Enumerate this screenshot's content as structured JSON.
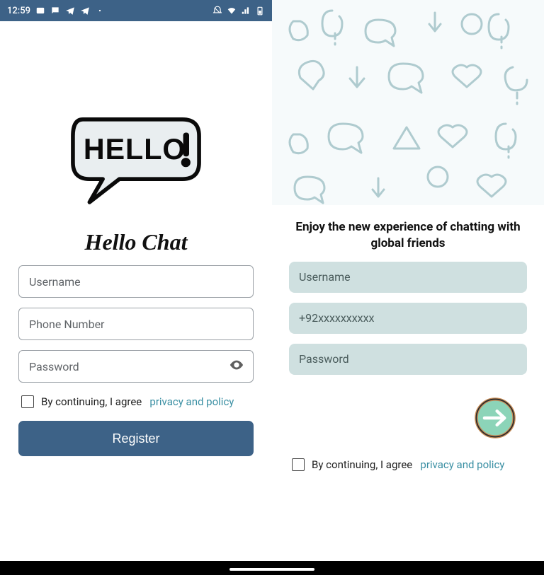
{
  "statusbar": {
    "time": "12:59",
    "left_icons": [
      "image-icon",
      "message-icon",
      "telegram-icon",
      "telegram-icon",
      "dot-icon"
    ],
    "right_icons": [
      "dnd-icon",
      "wifi-icon",
      "signal-icon",
      "battery-icon"
    ]
  },
  "left": {
    "logo_text": "HELLO!",
    "app_title": "Hello Chat",
    "fields": {
      "username_placeholder": "Username",
      "phone_placeholder": "Phone Number",
      "password_placeholder": "Password"
    },
    "agree": {
      "prefix": "By continuing, I agree",
      "link": "privacy and policy"
    },
    "register_label": "Register"
  },
  "right": {
    "headline": "Enjoy the new experience of chatting with global friends",
    "fields": {
      "username_placeholder": "Username",
      "phone_placeholder": "+92xxxxxxxxxx",
      "password_placeholder": "Password"
    },
    "agree": {
      "prefix": "By continuing, I agree",
      "link": "privacy and policy"
    }
  },
  "colors": {
    "primary": "#3d6287",
    "field_bg_right": "#cfe0e0",
    "link": "#3a8fa3",
    "go_fill": "#8cd4b8",
    "go_ring": "#c98e58"
  }
}
